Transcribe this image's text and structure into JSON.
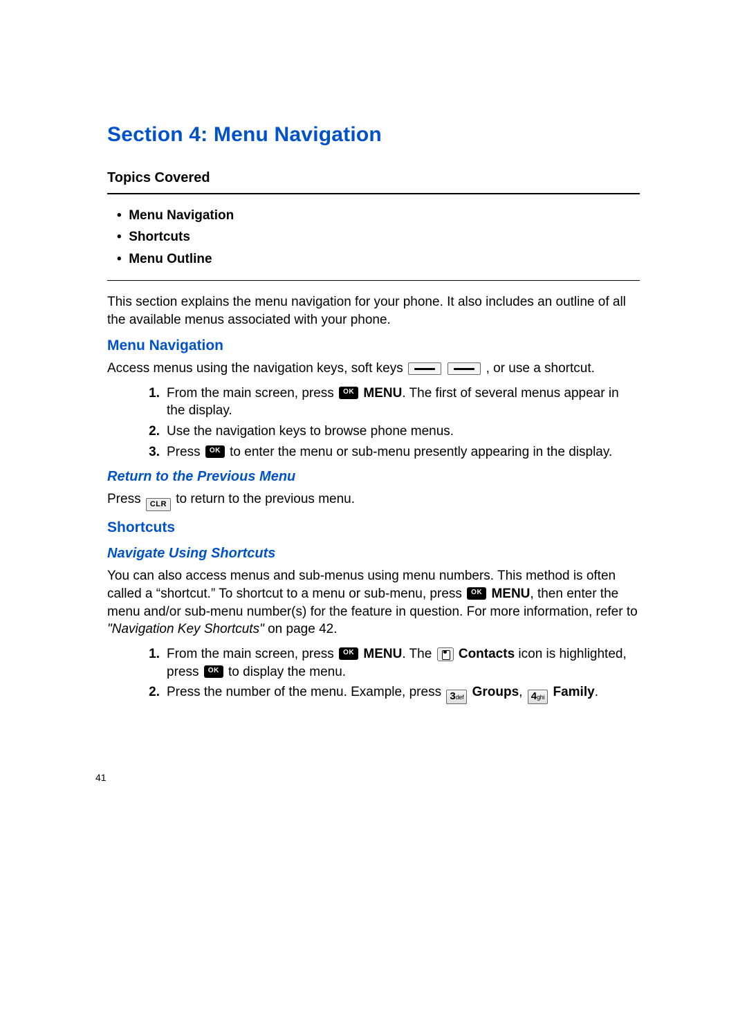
{
  "page_number": "41",
  "section_title": "Section 4: Menu Navigation",
  "topics_label": "Topics Covered",
  "topics": [
    "Menu Navigation",
    "Shortcuts",
    "Menu Outline"
  ],
  "intro": "This section explains the menu navigation for your phone. It also includes an outline of all the available menus associated with your phone.",
  "h2_menu_nav": "Menu Navigation",
  "nav_para_pre": "Access menus using the navigation keys, soft keys ",
  "nav_para_post": ", or use a shortcut.",
  "nav_steps": {
    "s1_pre": "From the main screen, press ",
    "s1_bold": "MENU",
    "s1_post": ". The first of several menus appear in the display.",
    "s2": "Use the navigation keys to browse phone menus.",
    "s3_pre": "Press ",
    "s3_post": " to enter the menu or sub-menu presently appearing in the display."
  },
  "h3_return": "Return to the Previous Menu",
  "return_pre": "Press ",
  "return_post": " to return to the previous menu.",
  "clr_label": "CLR",
  "h2_shortcuts": "Shortcuts",
  "h3_nav_shortcuts": "Navigate Using Shortcuts",
  "shortcuts_para_1": "You can also access menus and sub-menus using menu numbers. This method is often called a “shortcut.” To shortcut to a menu or sub-menu, press ",
  "shortcuts_bold_menu": "MENU",
  "shortcuts_para_2": ", then enter the menu and/or sub-menu number(s) for the feature in question. For more information, refer to ",
  "shortcuts_ref": "\"Navigation Key Shortcuts\"",
  "shortcuts_para_3": " on page 42.",
  "sc_steps": {
    "s1_pre": "From the main screen, press ",
    "s1_menu": "MENU",
    "s1_mid": ". The ",
    "s1_contacts": "Contacts",
    "s1_mid2": " icon is highlighted, press ",
    "s1_post": " to display the menu.",
    "s2_pre": "Press the number of the menu. Example, press ",
    "s2_key3_big": "3",
    "s2_key3_sm": "def",
    "s2_groups": "Groups",
    "s2_mid": ", ",
    "s2_key4_big": "4",
    "s2_key4_sm": "ghi",
    "s2_family": "Family",
    "s2_post": "."
  }
}
